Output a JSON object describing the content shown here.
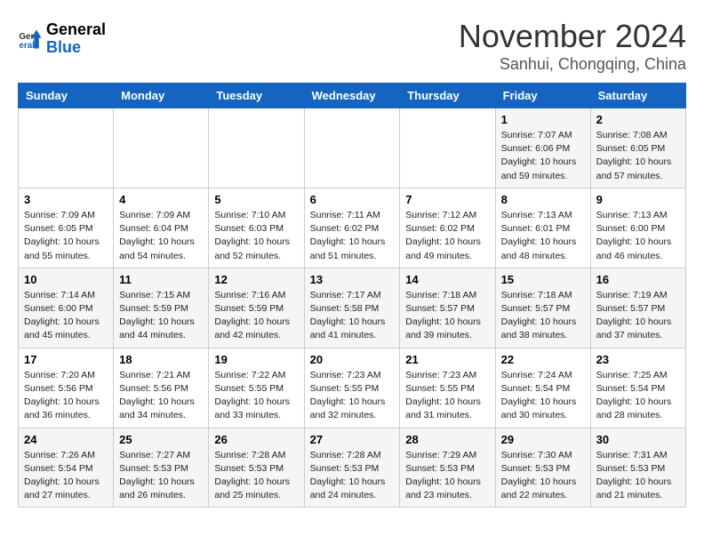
{
  "logo": {
    "general": "General",
    "blue": "Blue"
  },
  "title": "November 2024",
  "subtitle": "Sanhui, Chongqing, China",
  "weekdays": [
    "Sunday",
    "Monday",
    "Tuesday",
    "Wednesday",
    "Thursday",
    "Friday",
    "Saturday"
  ],
  "weeks": [
    [
      {
        "day": "",
        "info": ""
      },
      {
        "day": "",
        "info": ""
      },
      {
        "day": "",
        "info": ""
      },
      {
        "day": "",
        "info": ""
      },
      {
        "day": "",
        "info": ""
      },
      {
        "day": "1",
        "info": "Sunrise: 7:07 AM\nSunset: 6:06 PM\nDaylight: 10 hours and 59 minutes."
      },
      {
        "day": "2",
        "info": "Sunrise: 7:08 AM\nSunset: 6:05 PM\nDaylight: 10 hours and 57 minutes."
      }
    ],
    [
      {
        "day": "3",
        "info": "Sunrise: 7:09 AM\nSunset: 6:05 PM\nDaylight: 10 hours and 55 minutes."
      },
      {
        "day": "4",
        "info": "Sunrise: 7:09 AM\nSunset: 6:04 PM\nDaylight: 10 hours and 54 minutes."
      },
      {
        "day": "5",
        "info": "Sunrise: 7:10 AM\nSunset: 6:03 PM\nDaylight: 10 hours and 52 minutes."
      },
      {
        "day": "6",
        "info": "Sunrise: 7:11 AM\nSunset: 6:02 PM\nDaylight: 10 hours and 51 minutes."
      },
      {
        "day": "7",
        "info": "Sunrise: 7:12 AM\nSunset: 6:02 PM\nDaylight: 10 hours and 49 minutes."
      },
      {
        "day": "8",
        "info": "Sunrise: 7:13 AM\nSunset: 6:01 PM\nDaylight: 10 hours and 48 minutes."
      },
      {
        "day": "9",
        "info": "Sunrise: 7:13 AM\nSunset: 6:00 PM\nDaylight: 10 hours and 46 minutes."
      }
    ],
    [
      {
        "day": "10",
        "info": "Sunrise: 7:14 AM\nSunset: 6:00 PM\nDaylight: 10 hours and 45 minutes."
      },
      {
        "day": "11",
        "info": "Sunrise: 7:15 AM\nSunset: 5:59 PM\nDaylight: 10 hours and 44 minutes."
      },
      {
        "day": "12",
        "info": "Sunrise: 7:16 AM\nSunset: 5:59 PM\nDaylight: 10 hours and 42 minutes."
      },
      {
        "day": "13",
        "info": "Sunrise: 7:17 AM\nSunset: 5:58 PM\nDaylight: 10 hours and 41 minutes."
      },
      {
        "day": "14",
        "info": "Sunrise: 7:18 AM\nSunset: 5:57 PM\nDaylight: 10 hours and 39 minutes."
      },
      {
        "day": "15",
        "info": "Sunrise: 7:18 AM\nSunset: 5:57 PM\nDaylight: 10 hours and 38 minutes."
      },
      {
        "day": "16",
        "info": "Sunrise: 7:19 AM\nSunset: 5:57 PM\nDaylight: 10 hours and 37 minutes."
      }
    ],
    [
      {
        "day": "17",
        "info": "Sunrise: 7:20 AM\nSunset: 5:56 PM\nDaylight: 10 hours and 36 minutes."
      },
      {
        "day": "18",
        "info": "Sunrise: 7:21 AM\nSunset: 5:56 PM\nDaylight: 10 hours and 34 minutes."
      },
      {
        "day": "19",
        "info": "Sunrise: 7:22 AM\nSunset: 5:55 PM\nDaylight: 10 hours and 33 minutes."
      },
      {
        "day": "20",
        "info": "Sunrise: 7:23 AM\nSunset: 5:55 PM\nDaylight: 10 hours and 32 minutes."
      },
      {
        "day": "21",
        "info": "Sunrise: 7:23 AM\nSunset: 5:55 PM\nDaylight: 10 hours and 31 minutes."
      },
      {
        "day": "22",
        "info": "Sunrise: 7:24 AM\nSunset: 5:54 PM\nDaylight: 10 hours and 30 minutes."
      },
      {
        "day": "23",
        "info": "Sunrise: 7:25 AM\nSunset: 5:54 PM\nDaylight: 10 hours and 28 minutes."
      }
    ],
    [
      {
        "day": "24",
        "info": "Sunrise: 7:26 AM\nSunset: 5:54 PM\nDaylight: 10 hours and 27 minutes."
      },
      {
        "day": "25",
        "info": "Sunrise: 7:27 AM\nSunset: 5:53 PM\nDaylight: 10 hours and 26 minutes."
      },
      {
        "day": "26",
        "info": "Sunrise: 7:28 AM\nSunset: 5:53 PM\nDaylight: 10 hours and 25 minutes."
      },
      {
        "day": "27",
        "info": "Sunrise: 7:28 AM\nSunset: 5:53 PM\nDaylight: 10 hours and 24 minutes."
      },
      {
        "day": "28",
        "info": "Sunrise: 7:29 AM\nSunset: 5:53 PM\nDaylight: 10 hours and 23 minutes."
      },
      {
        "day": "29",
        "info": "Sunrise: 7:30 AM\nSunset: 5:53 PM\nDaylight: 10 hours and 22 minutes."
      },
      {
        "day": "30",
        "info": "Sunrise: 7:31 AM\nSunset: 5:53 PM\nDaylight: 10 hours and 21 minutes."
      }
    ]
  ]
}
